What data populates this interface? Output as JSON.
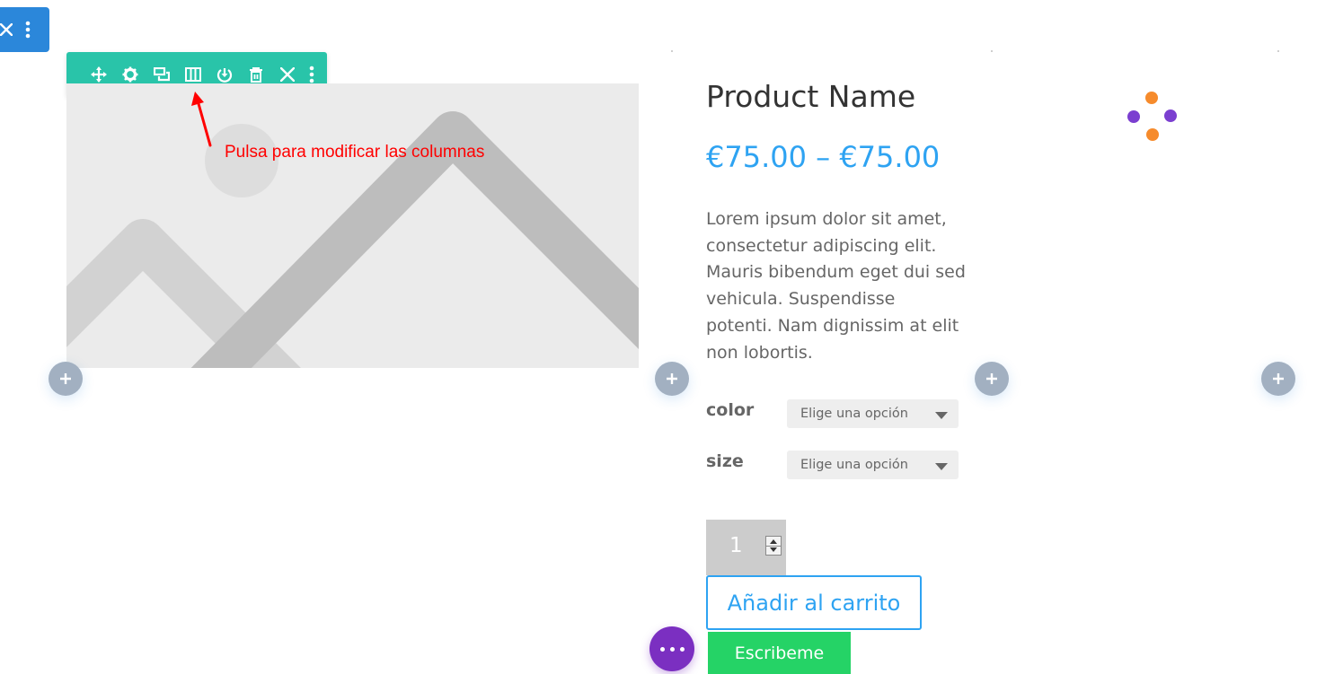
{
  "annotation": {
    "text": "Pulsa para modificar las columnas",
    "color": "#ff0000"
  },
  "section_toolbar": {
    "icons": [
      "close-icon",
      "more-vertical-icon"
    ],
    "color": "#2b87da"
  },
  "row_toolbar": {
    "color": "#29c4a9",
    "icons": [
      "move-icon",
      "gear-icon",
      "duplicate-icon",
      "columns-icon",
      "save-icon",
      "trash-icon",
      "close-icon",
      "more-vertical-icon"
    ]
  },
  "product": {
    "name": "Product Name",
    "price": "€75.00 – €75.00",
    "description": "Lorem ipsum dolor sit amet, consectetur adipiscing elit. Mauris bibendum eget dui sed vehicula. Suspendisse potenti. Nam dignissim at elit non lobortis.",
    "attributes": [
      {
        "label": "color",
        "select_value": "Elige una opción"
      },
      {
        "label": "size",
        "select_value": "Elige una opción"
      }
    ],
    "quantity": "1",
    "add_to_cart": "Añadir al carrito"
  },
  "whatsapp_button": {
    "label": "Escribeme",
    "color": "#25d366"
  },
  "fab": {
    "icon": "more-horizontal-icon",
    "color": "#7b2fc1"
  },
  "loader": {
    "icon": "loading-dots-icon",
    "colors": [
      "#f68b2c",
      "#7b3fd0"
    ]
  },
  "colors": {
    "accent": "#2ea3f2",
    "add_row": "#a2b0c1",
    "placeholder": "#ebebeb"
  }
}
